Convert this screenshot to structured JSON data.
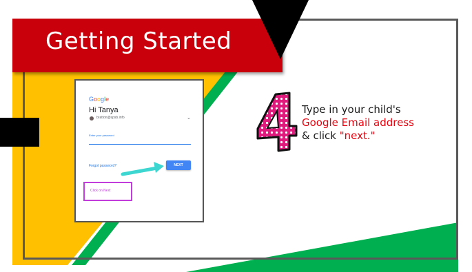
{
  "slide": {
    "title": "Getting Started",
    "colors": {
      "title_bar": "#c9000b",
      "yellow": "#ffc000",
      "green": "#00b050",
      "frame": "#595959",
      "highlight": "#e8000c"
    },
    "step_number": "4"
  },
  "login_card": {
    "logo": [
      "G",
      "o",
      "o",
      "g",
      "l",
      "e"
    ],
    "logo_colors": [
      "#4285f4",
      "#ea4335",
      "#fbbc05",
      "#4285f4",
      "#34a853",
      "#ea4335"
    ],
    "greeting": "Hi Tanya",
    "account": "bratton@spsb.info",
    "password_label": "Enter your password",
    "forgot_link": "Forgot password?",
    "next_button": "NEXT",
    "callout": "Click on Next",
    "callout_color": "#c23cdc",
    "arrow_color": "#3ed6d0"
  },
  "instruction": {
    "line1": "Type in your child's",
    "line2": "Google Email address",
    "line3_prefix": "& click ",
    "line3_highlight": "\"next.\""
  }
}
